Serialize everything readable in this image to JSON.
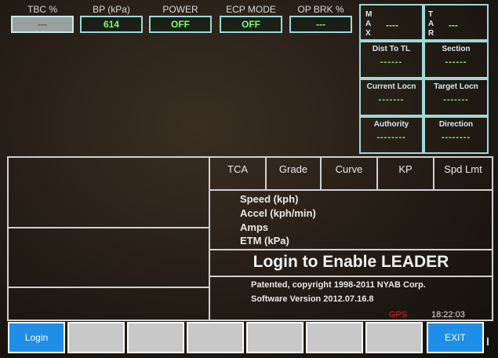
{
  "gauges": [
    {
      "label": "TBC %",
      "value": "---"
    },
    {
      "label": "BP (kPa)",
      "value": "614"
    },
    {
      "label": "POWER",
      "value": "OFF"
    },
    {
      "label": "ECP MODE",
      "value": "OFF"
    },
    {
      "label": "OP BRK %",
      "value": "---"
    }
  ],
  "max": {
    "label_m": "M",
    "label_a": "A",
    "label_x": "X",
    "value": "----"
  },
  "tar": {
    "label_t": "T",
    "label_a": "A",
    "label_r": "R",
    "value": "---"
  },
  "info": {
    "dist_to_tl": {
      "title": "Dist To TL",
      "value": "------"
    },
    "section": {
      "title": "Section",
      "value": "------"
    },
    "current_locn": {
      "title": "Current Locn",
      "value": "-------"
    },
    "target_locn": {
      "title": "Target Locn",
      "value": "-------"
    },
    "authority": {
      "title": "Authority",
      "value": "--------"
    },
    "direction": {
      "title": "Direction",
      "value": "--------"
    }
  },
  "track_headers": [
    "TCA",
    "Grade",
    "Curve",
    "KP",
    "Spd Lmt"
  ],
  "readouts": {
    "speed": "Speed  (kph)",
    "accel": "Accel  (kph/min)",
    "amps": "Amps",
    "etm": "ETM  (kPa)"
  },
  "login_message": "Login to Enable LEADER",
  "patent": "Patented, copyright 1998-2011 NYAB Corp.",
  "software_version": "Software Version 2012.07.16.8",
  "status": {
    "gps": "GPS",
    "time": "18:22:03",
    "gps_color": "#e02020"
  },
  "buttons": {
    "login": "Login",
    "exit": "EXIT"
  },
  "colors": {
    "accent_green": "#7dff6a",
    "button_blue": "#1e8ee8",
    "border_cyan": "#9fd8d8"
  }
}
